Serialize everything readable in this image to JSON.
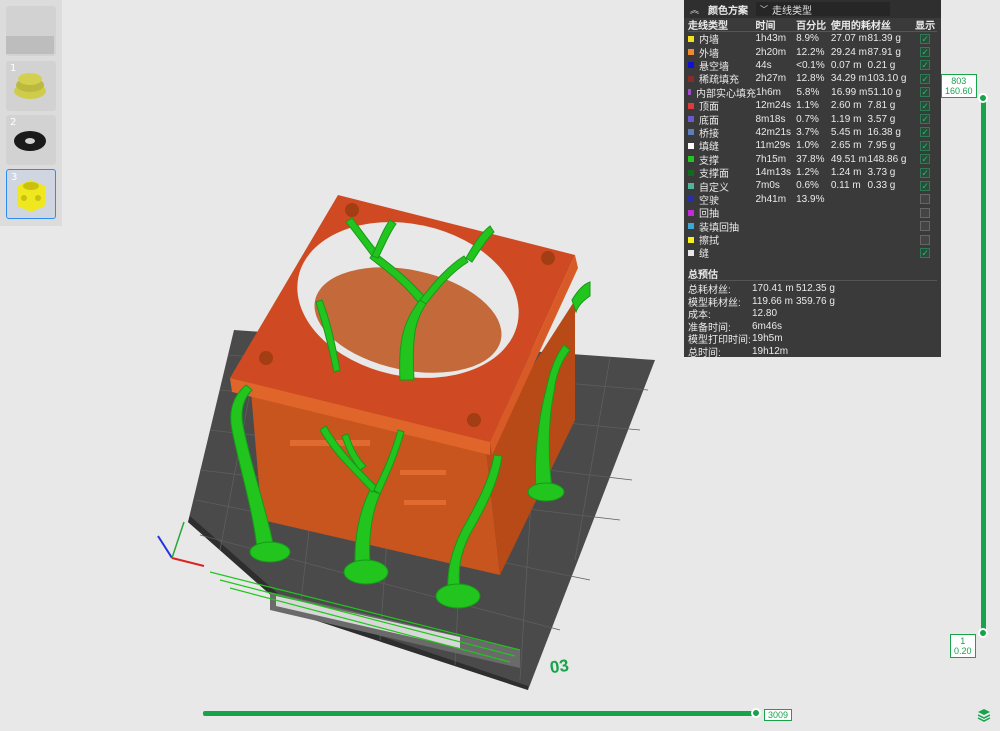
{
  "thumbnails": [
    {
      "index": "",
      "color": "#d6d6d6"
    },
    {
      "index": "1",
      "color": "#cfcc4b"
    },
    {
      "index": "2",
      "color": "#cfcfcf"
    },
    {
      "index": "3",
      "color": "#f0e81f"
    }
  ],
  "panel": {
    "collapse_icon": "chevron-up-double-icon",
    "title": "颜色方案",
    "scheme_value": "走线类型",
    "headers": {
      "type": "走线类型",
      "time": "时间",
      "pct": "百分比",
      "usage": "使用的耗材丝",
      "show": "显示"
    },
    "rows": [
      {
        "label": "内墙",
        "color": "#f5e11b",
        "time": "1h43m",
        "pct": "8.9%",
        "len": "27.07 m",
        "wt": "81.39 g",
        "show": true
      },
      {
        "label": "外墙",
        "color": "#f08a2e",
        "time": "2h20m",
        "pct": "12.2%",
        "len": "29.24 m",
        "wt": "87.91 g",
        "show": true
      },
      {
        "label": "悬空墙",
        "color": "#1010d8",
        "time": "44s",
        "pct": "<0.1%",
        "len": "0.07 m",
        "wt": "0.21 g",
        "show": true
      },
      {
        "label": "稀疏填充",
        "color": "#8b2a2a",
        "time": "2h27m",
        "pct": "12.8%",
        "len": "34.29 m",
        "wt": "103.10 g",
        "show": true
      },
      {
        "label": "内部实心填充",
        "color": "#a24dc8",
        "time": "1h6m",
        "pct": "5.8%",
        "len": "16.99 m",
        "wt": "51.10 g",
        "show": true
      },
      {
        "label": "顶面",
        "color": "#e23a3a",
        "time": "12m24s",
        "pct": "1.1%",
        "len": "2.60 m",
        "wt": "7.81 g",
        "show": true
      },
      {
        "label": "底面",
        "color": "#6a5acd",
        "time": "8m18s",
        "pct": "0.7%",
        "len": "1.19 m",
        "wt": "3.57 g",
        "show": true
      },
      {
        "label": "桥接",
        "color": "#5a7fbf",
        "time": "42m21s",
        "pct": "3.7%",
        "len": "5.45 m",
        "wt": "16.38 g",
        "show": true
      },
      {
        "label": "填缝",
        "color": "#ffffff",
        "time": "11m29s",
        "pct": "1.0%",
        "len": "2.65 m",
        "wt": "7.95 g",
        "show": true
      },
      {
        "label": "支撑",
        "color": "#22c51e",
        "time": "7h15m",
        "pct": "37.8%",
        "len": "49.51 m",
        "wt": "148.86 g",
        "show": true
      },
      {
        "label": "支撑面",
        "color": "#0f6b1f",
        "time": "14m13s",
        "pct": "1.2%",
        "len": "1.24 m",
        "wt": "3.73 g",
        "show": true
      },
      {
        "label": "自定义",
        "color": "#4fb59a",
        "time": "7m0s",
        "pct": "0.6%",
        "len": "0.11 m",
        "wt": "0.33 g",
        "show": true
      },
      {
        "label": "空驶",
        "color": "#2a2fa8",
        "time": "2h41m",
        "pct": "13.9%",
        "len": "",
        "wt": "",
        "show": false
      },
      {
        "label": "回抽",
        "color": "#c22bd6",
        "time": "",
        "pct": "",
        "len": "",
        "wt": "",
        "show": false
      },
      {
        "label": "装填回抽",
        "color": "#3aa9d8",
        "time": "",
        "pct": "",
        "len": "",
        "wt": "",
        "show": false
      },
      {
        "label": "擦拭",
        "color": "#f7f21a",
        "time": "",
        "pct": "",
        "len": "",
        "wt": "",
        "show": false
      },
      {
        "label": "缝",
        "color": "#e8e8e8",
        "time": "",
        "pct": "",
        "len": "",
        "wt": "",
        "show": true
      }
    ],
    "summary_title": "总预估",
    "summary": [
      {
        "k": "总耗材丝:",
        "v1": "170.41 m",
        "v2": "512.35 g"
      },
      {
        "k": "模型耗材丝:",
        "v1": "119.66 m",
        "v2": "359.76 g"
      },
      {
        "k": "成本:",
        "v1": "12.80",
        "v2": ""
      },
      {
        "k": "准备时间:",
        "v1": "6m46s",
        "v2": ""
      },
      {
        "k": "模型打印时间:",
        "v1": "19h5m",
        "v2": ""
      },
      {
        "k": "总时间:",
        "v1": "19h12m",
        "v2": ""
      }
    ]
  },
  "layer_slider": {
    "top_layer": "803",
    "top_height": "160.60",
    "bottom_layer": "1",
    "bottom_height": "0.20",
    "top_position": 1.0,
    "bottom_position": 0.0
  },
  "move_slider": {
    "value": "3009",
    "position": 1.0
  },
  "plate_number": "03",
  "colors": {
    "accent": "#16a34a",
    "model": "#c8541e",
    "support": "#22c51e"
  }
}
